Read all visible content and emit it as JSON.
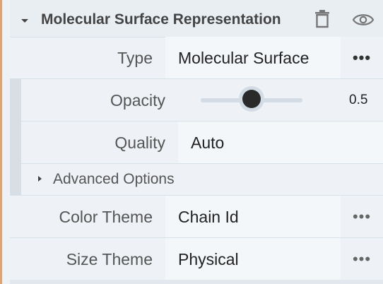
{
  "header": {
    "title": "Molecular Surface Representation",
    "icons": [
      "caret-down-icon",
      "trash-icon",
      "eye-icon"
    ]
  },
  "rows": {
    "type": {
      "label": "Type",
      "value": "Molecular Surface",
      "more": "•••"
    },
    "opacity": {
      "label": "Opacity",
      "value": "0.5",
      "level": 0.5
    },
    "quality": {
      "label": "Quality",
      "value": "Auto"
    },
    "advanced": {
      "label": "Advanced Options"
    },
    "color_theme": {
      "label": "Color Theme",
      "value": "Chain Id",
      "more": "•••"
    },
    "size_theme": {
      "label": "Size Theme",
      "value": "Physical",
      "more": "•••"
    }
  },
  "colors": {
    "accent_left": "#e3a36a",
    "panel_bg": "#eef2f6",
    "value_bg": "#f4f7fa",
    "slider_knob": "#2a2a2a"
  }
}
